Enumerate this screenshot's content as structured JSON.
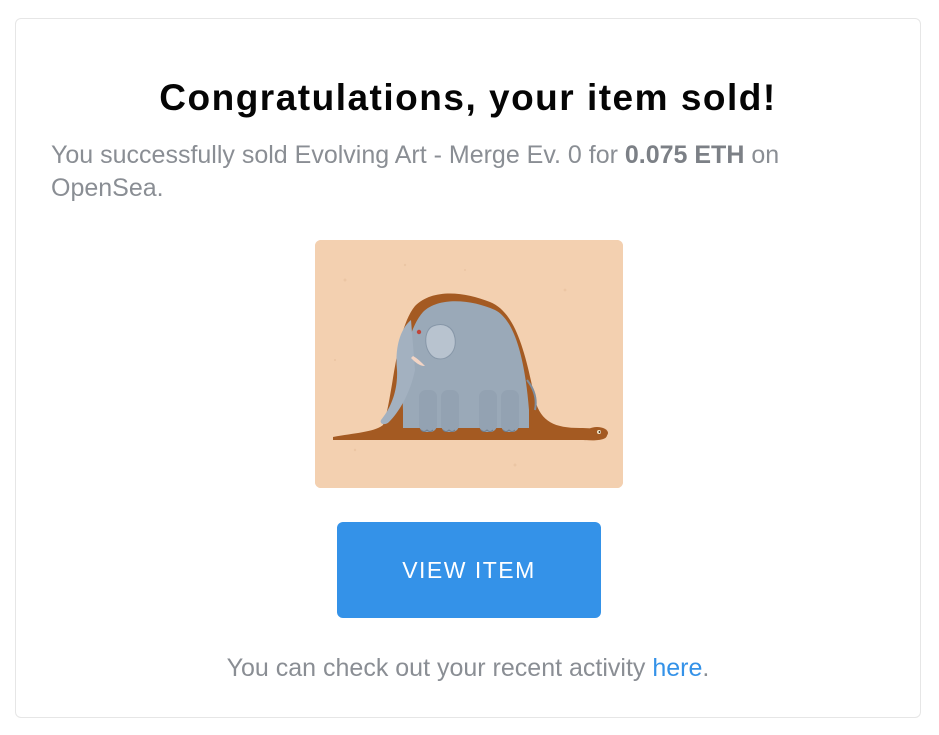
{
  "email": {
    "title": "Congratulations, your item sold!",
    "message": {
      "prefix": "You successfully sold Evolving Art - Merge Ev. 0 for ",
      "price": "0.075 ETH",
      "suffix": " on OpenSea."
    },
    "image": {
      "description_icon": "elephant-on-turtle-artwork"
    },
    "button": {
      "label": "VIEW ITEM"
    },
    "footer": {
      "prefix": "You can check out your recent activity ",
      "link": "here",
      "suffix": "."
    }
  },
  "colors": {
    "accent": "#3492e8",
    "text_muted": "#8a8e94",
    "title": "#050505",
    "art_background": "#f3d0b0"
  }
}
